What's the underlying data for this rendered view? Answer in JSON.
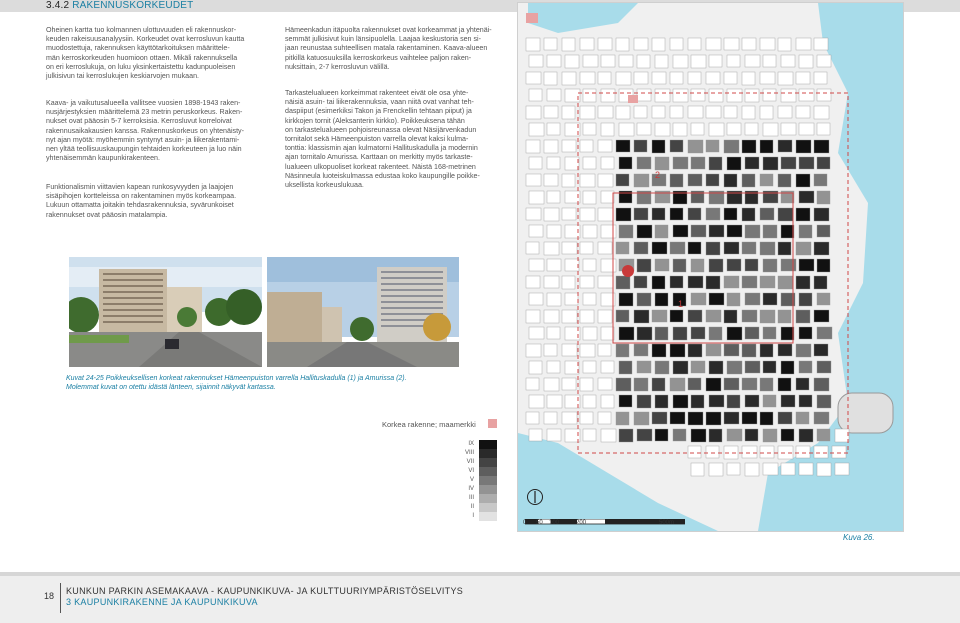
{
  "header": {
    "section_number": "3.4.2",
    "section_title": "RAKENNUSKORKEUDET"
  },
  "left_column": {
    "paragraph_1": "Oheinen kartta tuo kolmannen ulottuvuuden eli rakennuskor-\nkeuden rakeisuusanalyysiin. Korkeudet ovat kerrosluvun kautta\nmuodostettuja, rakennuksen käyttötarkoituksen määrittele-\nmän kerroskorkeuden huomioon ottaen. Mikäli rakennuksella\non eri kerroslukuja, on luku yksinkertaistettu kadunpuoleisen\njulkisivun tai kerroslukujen keskiarvojen mukaan.",
    "paragraph_2": "Kaava- ja vaikutusalueella vallitsee vuosien 1898-1943 raken-\nnusjärjestyksien määrittelemä 23 metrin peruskorkeus. Raken-\nnukset ovat pääosin 5-7 kerroksisia. Kerrosluvut korreloivat\nrakennusaikakausien kanssa. Rakennuskorkeus on yhtenäisty-\nnyt ajan myötä: myöhemmin syntynyt asuin- ja liikerakentami-\nnen yltää teollisuuskaupungin tehtaiden korkeuteen ja luo näin\nyhtenäisemmän kaupunkirakenteen.",
    "paragraph_3": "Funktionalismin viittavien kapean runkosyvyyden ja laajojen\nsisäpihojen kortteleissa on rakentaminen myös korkeampaa.\nLukuun ottamatta joitakin tehdasrakennuksia, syvärunkoiset\nrakennukset ovat pääosin matalampia."
  },
  "middle_column": {
    "paragraph_1": "Hämeenkadun itäpuolta rakennukset ovat korkeammat ja yhtenäi-\nsemmät julkisivut kuin länsipuolella. Laajaa keskustoria sen si-\njaan reunustaa suhteellisen matala rakentaminen. Kaava-alueen\npitkillä katuosuuksilla kerroskorkeus vaihtelee paljon raken-\nnuksittain, 2-7 kerrosluvun välillä.",
    "paragraph_2": "Tarkastelualueen korkeimmat rakenteet eivät ole osa yhte-\nnäisiä asuin- tai liikerakennuksia, vaan niitä ovat vanhat teh-\ndaspiiput (esimerkiksi Takon ja Frenckellin tehtaan piiput) ja\nkirkkojen tornit (Aleksanterin kirkko). Poikkeuksena tähän\non tarkastelualueen pohjoisreunassa olevat Näsijärvenkadun\ntornitalot sekä Hämeenpuiston varrella olevat kaksi kulma-\ntonttia: klassismin ajan kulmatorni Hallituskadulla ja modernin\najan tornitalo Amurissa. Karttaan on merkitty myös tarkaste-\nlualueen ulkopuoliset korkeat rakenteet. Näistä 168-metrinen\nNäsinneula luoteiskulmassa edustaa koko kaupungille poikke-\nuksellista korkeuslukuaa."
  },
  "caption": "Kuvat 24-25 Poikkeuksellisen korkeat rakennukset Hämeenpuiston varrella Hallituskadulla (1) ja Amurissa (2).\nMolemmat kuvat on otettu idästä länteen, sijainnit näkyvät kartassa.",
  "map": {
    "marker_1": "1",
    "marker_2": "2",
    "legend_special_label": "Korkea rakenne; maamerkki",
    "legend_special_color": "#e8a2a2",
    "legend_floors": [
      "IX",
      "VIII",
      "VII",
      "VI",
      "V",
      "IV",
      "III",
      "II",
      "I"
    ],
    "legend_colors": [
      "#111111",
      "#2a2a2a",
      "#444444",
      "#5e5e5e",
      "#787878",
      "#939393",
      "#adadad",
      "#c8c8c8",
      "#e2e2e2"
    ],
    "scale_ticks": [
      "0",
      "50",
      "100",
      "200",
      "500m"
    ],
    "water_color": "#a8dcea",
    "boundary_color": "#d04848"
  },
  "figure_number": "Kuva 26.",
  "footer": {
    "page_number": "18",
    "title": "KUNKUN PARKIN ASEMAKAAVA - KAUPUNKIKUVA- JA KULTTUURIYMPÄRISTÖSELVITYS",
    "subtitle": "3 KAUPUNKIRAKENNE JA KAUPUNKIKUVA"
  }
}
